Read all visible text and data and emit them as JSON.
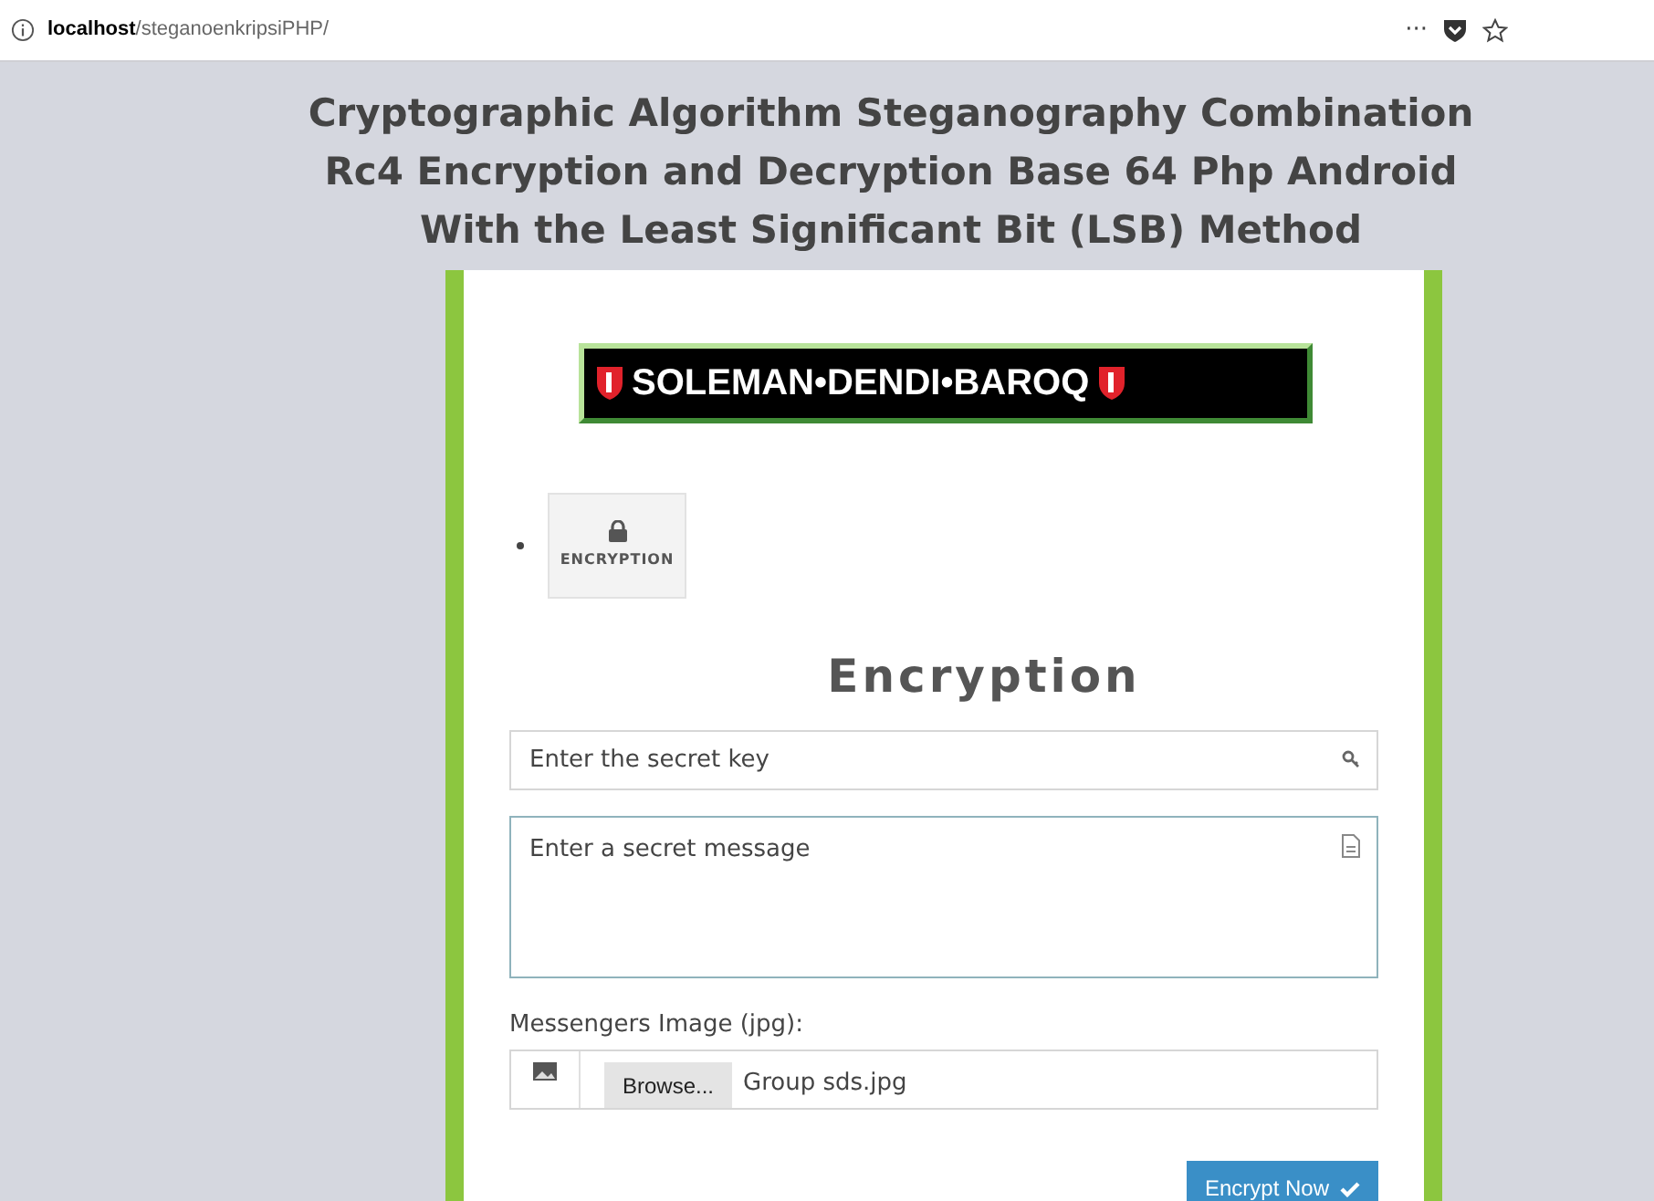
{
  "browser": {
    "url_host": "localhost",
    "url_path": "/steganoenkripsiPHP/",
    "menu": "···"
  },
  "title_lines": [
    "Cryptographic Algorithm Steganography Combination",
    "Rc4 Encryption and Decryption Base 64 Php Android",
    "With the Least Significant Bit (LSB) Method"
  ],
  "logo": {
    "text": "SOLEMAN•DENDI•BAROQ"
  },
  "menu_items": [
    {
      "label": "ENCRYPTION"
    }
  ],
  "heading": "Encryption",
  "key_field": {
    "placeholder": "Enter the secret key"
  },
  "message_field": {
    "placeholder": "Enter a secret message"
  },
  "image_label": "Messengers Image (jpg):",
  "file_input": {
    "button": "Browse...",
    "file_name": "Group sds.jpg"
  },
  "submit_button": "Encrypt Now"
}
